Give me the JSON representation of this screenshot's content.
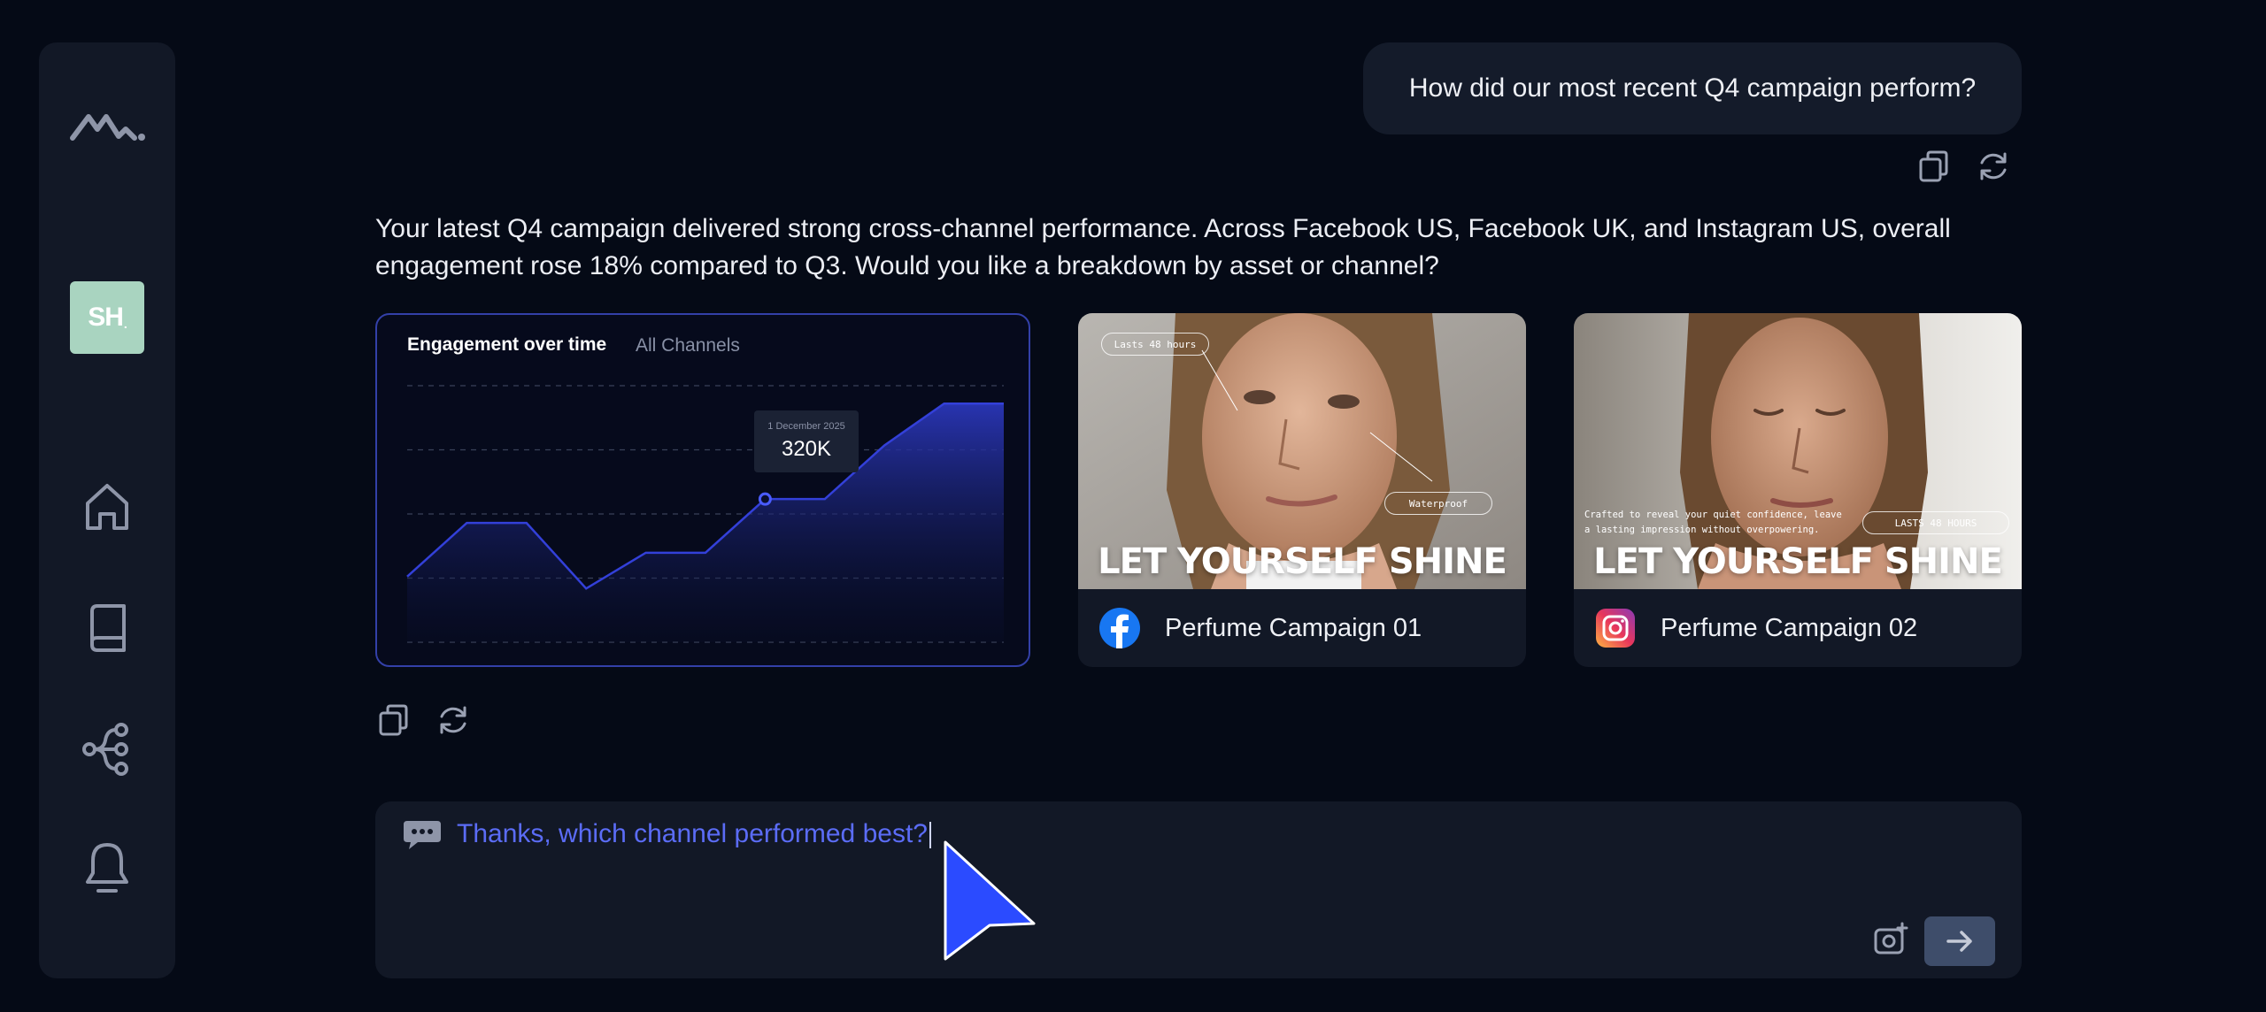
{
  "sidebar": {
    "avatar_initials": "SH",
    "avatar_suffix": ".",
    "items": [
      {
        "icon": "home-icon"
      },
      {
        "icon": "book-icon"
      },
      {
        "icon": "workflow-icon"
      },
      {
        "icon": "bell-icon"
      }
    ]
  },
  "conversation": {
    "user_message": "How did our most recent Q4 campaign perform?",
    "assistant_message": "Your latest Q4 campaign delivered strong cross-channel performance. Across Facebook US, Facebook UK, and Instagram US, overall engagement rose 18% compared to Q3. Would you like a breakdown by asset or channel?"
  },
  "chart": {
    "title": "Engagement over time",
    "subtitle": "All Channels",
    "tooltip_date": "1 December 2025",
    "tooltip_value": "320K",
    "accent_color": "#3340d9"
  },
  "chart_data": {
    "type": "area",
    "title": "Engagement over time",
    "subtitle": "All Channels",
    "x": [
      0,
      1,
      2,
      3,
      4,
      5,
      6,
      7,
      8,
      9,
      10
    ],
    "values": [
      110,
      200,
      200,
      90,
      150,
      150,
      240,
      240,
      330,
      400,
      400
    ],
    "ylim": [
      0,
      430
    ],
    "grid": true,
    "highlight_index": 6
  },
  "campaigns": [
    {
      "name": "Perfume Campaign 01",
      "channel": "facebook",
      "headline": "LET YOURSELF SHINE",
      "tag_1": "Lasts 48 hours",
      "tag_2": "Waterproof"
    },
    {
      "name": "Perfume Campaign 02",
      "channel": "instagram",
      "headline": "LET YOURSELF SHINE",
      "tag_1": "LASTS 48 HOURS",
      "blurb": "Crafted to reveal your quiet confidence, leave a lasting impression without overpowering."
    }
  ],
  "input": {
    "value": "Thanks, which channel performed best?"
  },
  "colors": {
    "background": "#050a16",
    "panel": "#121826",
    "input_text": "#5b6cf6",
    "send_button": "#3e4d6a",
    "pointer": "#2b4bff"
  }
}
